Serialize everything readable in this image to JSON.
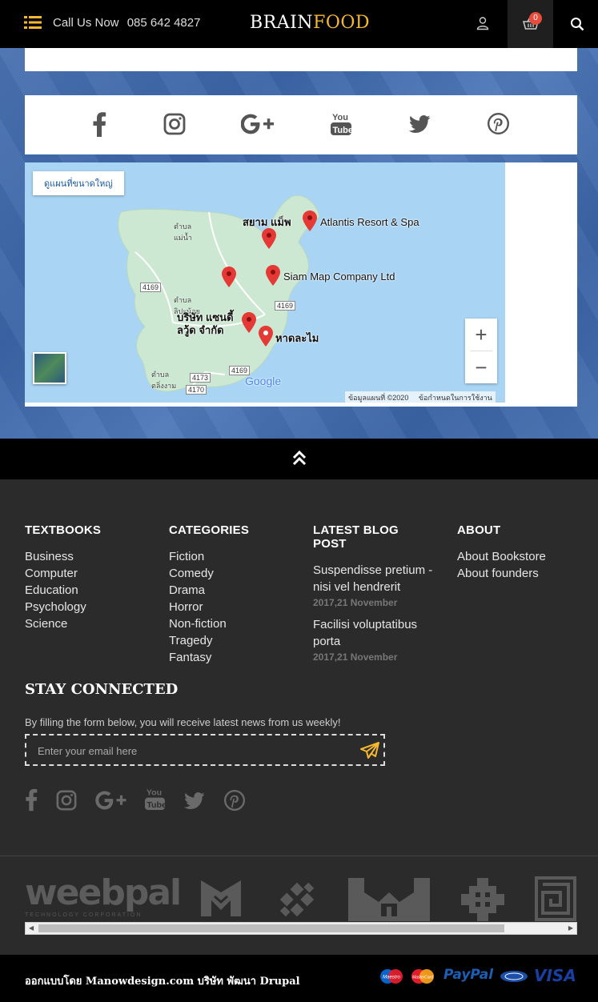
{
  "header": {
    "menu_icon": "list-icon",
    "call_label": "Call Us Now",
    "phone": "085 642 4827",
    "logo_a": "BRAIN",
    "logo_b": "FOOD",
    "cart_count": "0"
  },
  "social_top": [
    "facebook-icon",
    "instagram-icon",
    "google-plus-icon",
    "youtube-icon",
    "twitter-icon",
    "pinterest-icon"
  ],
  "map": {
    "view_larger": "ดูแผนที่ขนาดใหญ่",
    "labels": {
      "siam_mapp": "สยาม แม็พ",
      "atlantis": "Atlantis Resort & Spa",
      "siam_map_company": "Siam Map Company Ltd",
      "sandy": "บริษัท แซนดี้\nลวู้ด จำกัด",
      "beach": "หาดละไม",
      "tambon1": "ตำบล\nแม่น้ำ",
      "tambon2": "ตำบล\nลิปะน้อย",
      "tambon3": "ตำบล\nตลิ่งงาม"
    },
    "roads": [
      "4169",
      "4169",
      "4169",
      "4173",
      "4170"
    ],
    "zoom_in": "+",
    "zoom_out": "−",
    "attribution": "ข้อมูลแผนที่ ©2020",
    "terms": "ข้อกำหนดในการใช้งาน",
    "google": "Google"
  },
  "footer": {
    "textbooks": {
      "title": "TEXTBOOKS",
      "items": [
        "Business",
        "Computer",
        "Education",
        "Psychology",
        "Science"
      ]
    },
    "categories": {
      "title": "CATEGORIES",
      "items": [
        "Fiction",
        "Comedy",
        "Drama",
        "Horror",
        "Non-fiction",
        "Tragedy",
        "Fantasy"
      ]
    },
    "blog": {
      "title": "LATEST BLOG POST",
      "posts": [
        {
          "title": "Suspendisse pretium - nisi vel hendrerit",
          "date": "2017,21 November"
        },
        {
          "title": "Facilisi voluptatibus porta",
          "date": "2017,21 November"
        }
      ]
    },
    "about": {
      "title": "ABOUT",
      "items": [
        "About Bookstore",
        "About founders"
      ]
    },
    "stay_title": "STAY CONNECTED",
    "stay_desc": "By filling the form below, you will receive latest news from us weekly!",
    "email_placeholder": "Enter your email here"
  },
  "brands": {
    "weebpal": "weebpal",
    "weebpal_sub": "TECHNOLOGY CORPORATION"
  },
  "credit": "ออกแบบโดย Manowdesign.com บริษัท พัฒนา Drupal",
  "payments": [
    "Maestro",
    "MasterCard",
    "PayPal",
    "",
    "VISA"
  ],
  "colors": {
    "accent": "#f6b731",
    "badge": "#e74c3c",
    "pin": "#e53935"
  }
}
